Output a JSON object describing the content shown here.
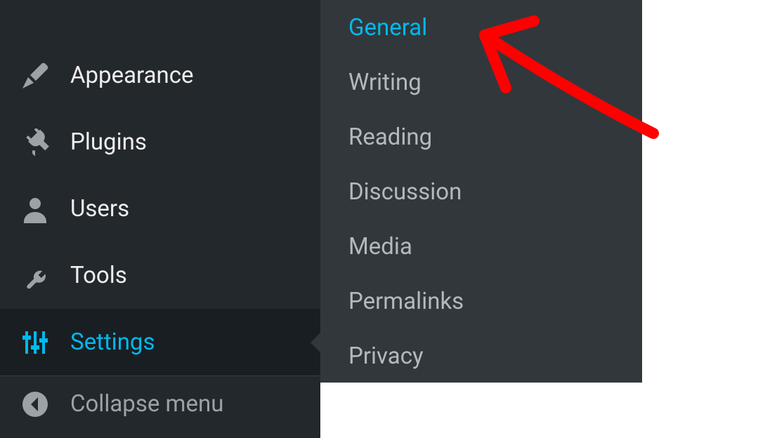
{
  "sidebar": {
    "items": [
      {
        "label": "Appearance",
        "icon": "brush-icon"
      },
      {
        "label": "Plugins",
        "icon": "plug-icon"
      },
      {
        "label": "Users",
        "icon": "user-icon"
      },
      {
        "label": "Tools",
        "icon": "wrench-icon"
      },
      {
        "label": "Settings",
        "icon": "sliders-icon",
        "active": true
      }
    ],
    "collapse_label": "Collapse menu"
  },
  "submenu": {
    "items": [
      {
        "label": "General",
        "active": true
      },
      {
        "label": "Writing"
      },
      {
        "label": "Reading"
      },
      {
        "label": "Discussion"
      },
      {
        "label": "Media"
      },
      {
        "label": "Permalinks"
      },
      {
        "label": "Privacy"
      }
    ]
  },
  "colors": {
    "accent": "#00b9eb",
    "sidebar_bg": "#23282d",
    "submenu_bg": "#32373c",
    "annotation": "#ff0000"
  }
}
